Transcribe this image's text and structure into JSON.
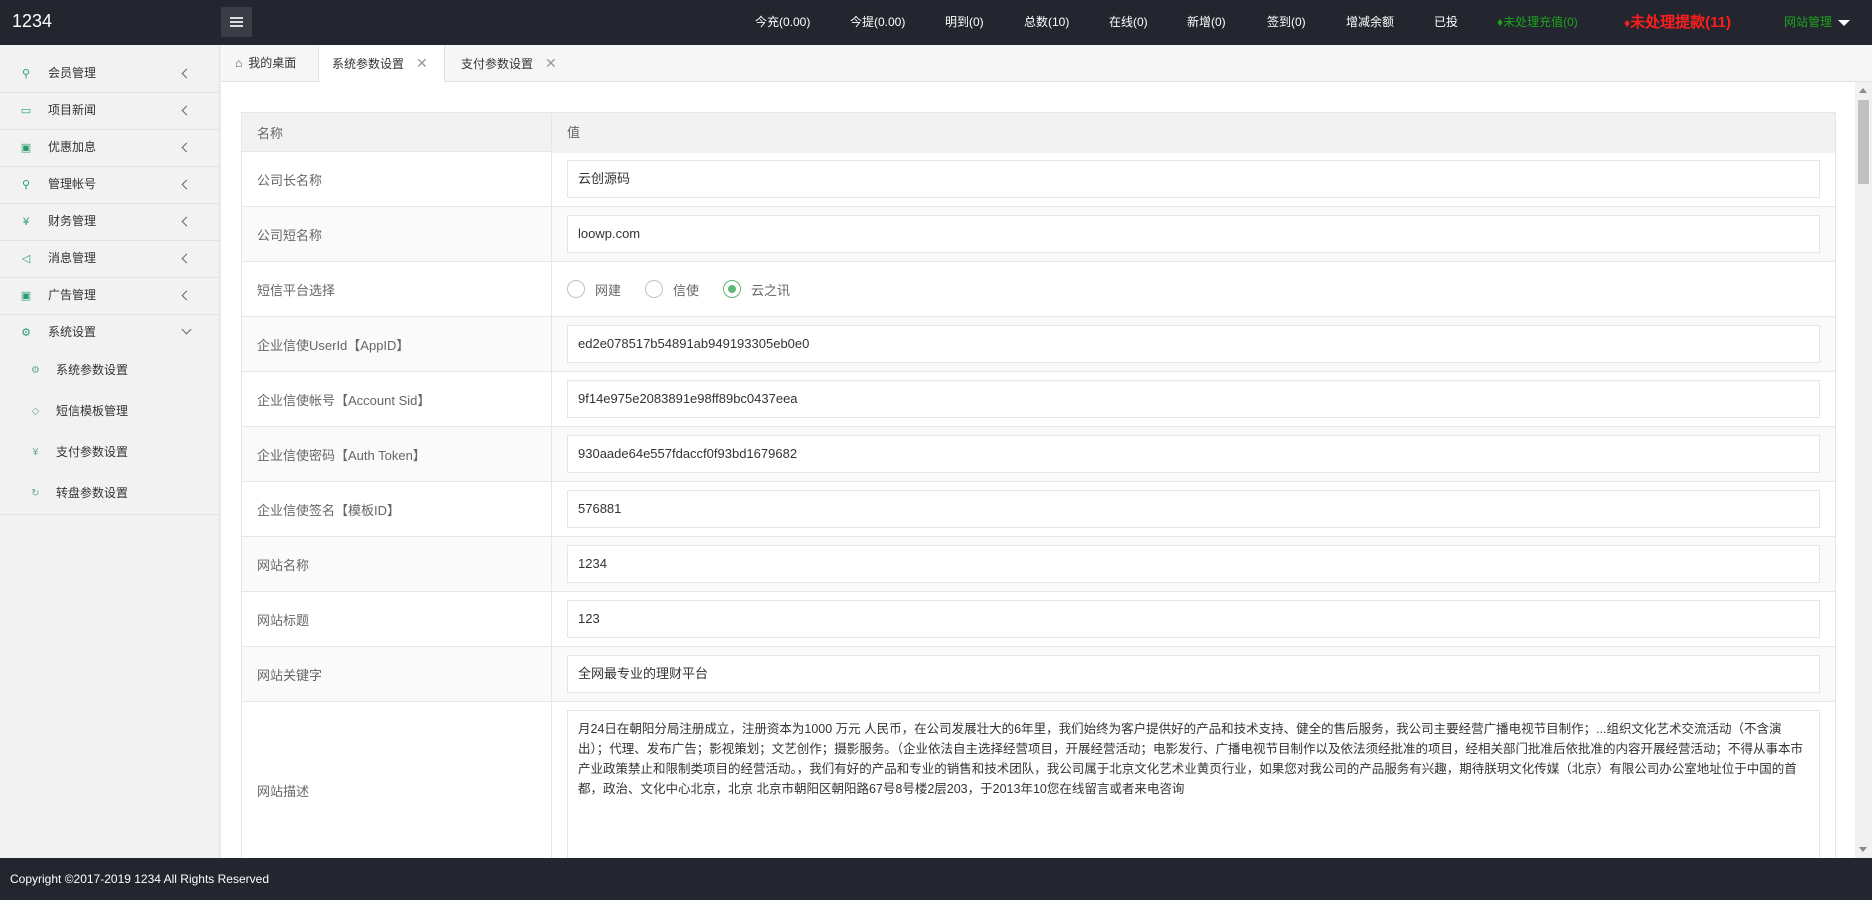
{
  "app": {
    "logo": "1234"
  },
  "header_nav": [
    {
      "label": "今充(0.00)"
    },
    {
      "label": "今提(0.00)"
    },
    {
      "label": "明到(0)"
    },
    {
      "label": "总数(10)"
    },
    {
      "label": "在线(0)"
    },
    {
      "label": "新增(0)"
    },
    {
      "label": "签到(0)"
    },
    {
      "label": "增减余额"
    },
    {
      "label": "已投"
    },
    {
      "label": "未处理充值(0)",
      "color": "#1ea31e"
    },
    {
      "label": "未处理提款(11)",
      "color": "#ff1e1e"
    },
    {
      "label": "网站管理",
      "color": "#1ea31e"
    }
  ],
  "sidebar": {
    "items": [
      {
        "label": "会员管理",
        "icon": "user-icon"
      },
      {
        "label": "项目新闻",
        "icon": "book-icon"
      },
      {
        "label": "优惠加息",
        "icon": "image-icon"
      },
      {
        "label": "管理帐号",
        "icon": "user-icon"
      },
      {
        "label": "财务管理",
        "icon": "rmb-icon"
      },
      {
        "label": "消息管理",
        "icon": "speaker-icon"
      },
      {
        "label": "广告管理",
        "icon": "image-icon"
      },
      {
        "label": "系统设置",
        "icon": "gear-icon"
      }
    ],
    "sub_items": [
      {
        "label": "系统参数设置",
        "icon": "gear-icon"
      },
      {
        "label": "短信模板管理",
        "icon": "tag-icon"
      },
      {
        "label": "支付参数设置",
        "icon": "rmb-icon"
      },
      {
        "label": "转盘参数设置",
        "icon": "refresh-icon"
      }
    ]
  },
  "tabs": [
    {
      "label": "我的桌面"
    },
    {
      "label": "系统参数设置"
    },
    {
      "label": "支付参数设置"
    }
  ],
  "table": {
    "header": {
      "name": "名称",
      "value": "值"
    },
    "rows": [
      {
        "name": "公司长名称",
        "value": "云创源码"
      },
      {
        "name": "公司短名称",
        "value": "loowp.com"
      },
      {
        "name": "短信平台选择",
        "options": [
          "网建",
          "信使",
          "云之讯"
        ],
        "selected": "云之讯"
      },
      {
        "name": "企业信使UserId【AppID】",
        "value": "ed2e078517b54891ab949193305eb0e0"
      },
      {
        "name": "企业信使帐号【Account Sid】",
        "value": "9f14e975e2083891e98ff89bc0437eea"
      },
      {
        "name": "企业信使密码【Auth Token】",
        "value": "930aade64e557fdaccf0f93bd1679682"
      },
      {
        "name": "企业信使签名【模板ID】",
        "value": "576881"
      },
      {
        "name": "网站名称",
        "value": "1234"
      },
      {
        "name": "网站标题",
        "value": "123"
      },
      {
        "name": "网站关键字",
        "value": "全网最专业的理财平台"
      },
      {
        "name": "网站描述",
        "value": "月24日在朝阳分局注册成立，注册资本为1000 万元 人民币，在公司发展壮大的6年里，我们始终为客户提供好的产品和技术支持、健全的售后服务，我公司主要经营广播电视节目制作；...组织文化艺术交流活动（不含演出）；代理、发布广告；影视策划；文艺创作；摄影服务。（企业依法自主选择经营项目，开展经营活动；电影发行、广播电视节目制作以及依法须经批准的项目，经相关部门批准后依批准的内容开展经营活动；不得从事本市产业政策禁止和限制类项目的经营活动。，我们有好的产品和专业的销售和技术团队，我公司属于北京文化艺术业黄页行业，如果您对我公司的产品服务有兴趣，期待朕玥文化传媒（北京）有限公司办公室地址位于中国的首都，政治、文化中心北京，北京 北京市朝阳区朝阳路67号8号楼2层203，于2013年10您在线留言或者来电咨询"
      }
    ]
  },
  "footer": {
    "text": "Copyright ©2017-2019 1234 All Rights Reserved"
  }
}
